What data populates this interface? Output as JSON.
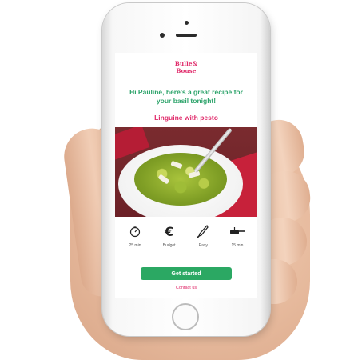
{
  "app": {
    "logo_text": "Bulle & Bouse",
    "greeting": "Hi Pauline, here's a great recipe for your basil tonight!",
    "recipe_name": "Linguine with pesto"
  },
  "stats": [
    {
      "icon": "stopwatch-icon",
      "label": "25 min"
    },
    {
      "icon": "euro-icon",
      "label": "Budget"
    },
    {
      "icon": "knife-icon",
      "label": "Easy"
    },
    {
      "icon": "pan-icon",
      "label": "15 min"
    }
  ],
  "actions": {
    "get_started_label": "Get started",
    "contact_label": "Contact us"
  },
  "colors": {
    "brand_pink": "#e02a6a",
    "brand_green": "#2ca36a",
    "button_green": "#2ba863"
  }
}
